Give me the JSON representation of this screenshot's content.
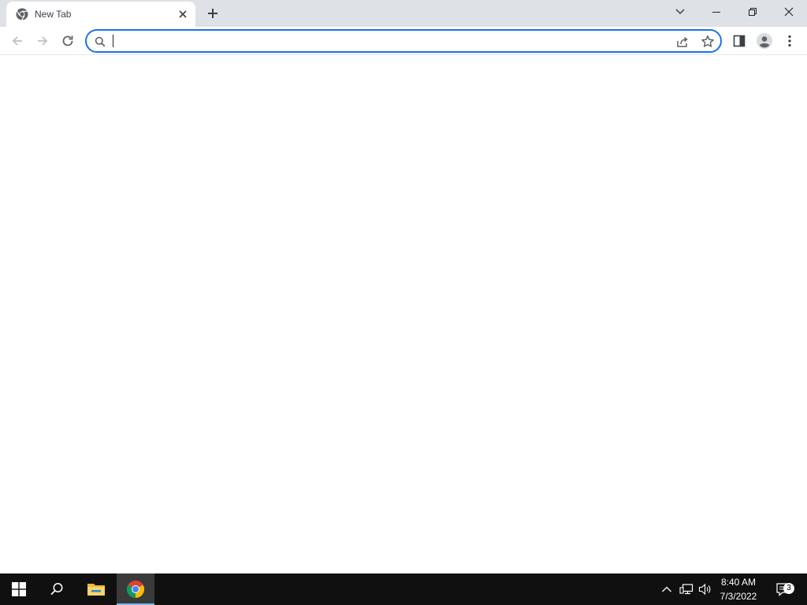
{
  "browser": {
    "tab": {
      "title": "New Tab",
      "icon": "chrome-favicon-icon"
    },
    "new_tab_icon": "plus-icon",
    "window_controls": [
      "tab-search-icon",
      "minimize-icon",
      "restore-icon",
      "close-icon"
    ],
    "toolbar": {
      "back_icon": "back-arrow-icon",
      "forward_icon": "forward-arrow-icon",
      "reload_icon": "reload-icon",
      "omnibox": {
        "value": "",
        "placeholder": ""
      },
      "side_panel_icon": "side-panel-icon",
      "profile_icon": "profile-avatar-icon",
      "menu_icon": "kebab-menu-icon"
    },
    "accent_color": "#1a73e8"
  },
  "taskbar": {
    "clock": {
      "time": "8:40 AM",
      "date": "7/3/2022"
    },
    "notification_count": "3",
    "background": "#101010"
  }
}
